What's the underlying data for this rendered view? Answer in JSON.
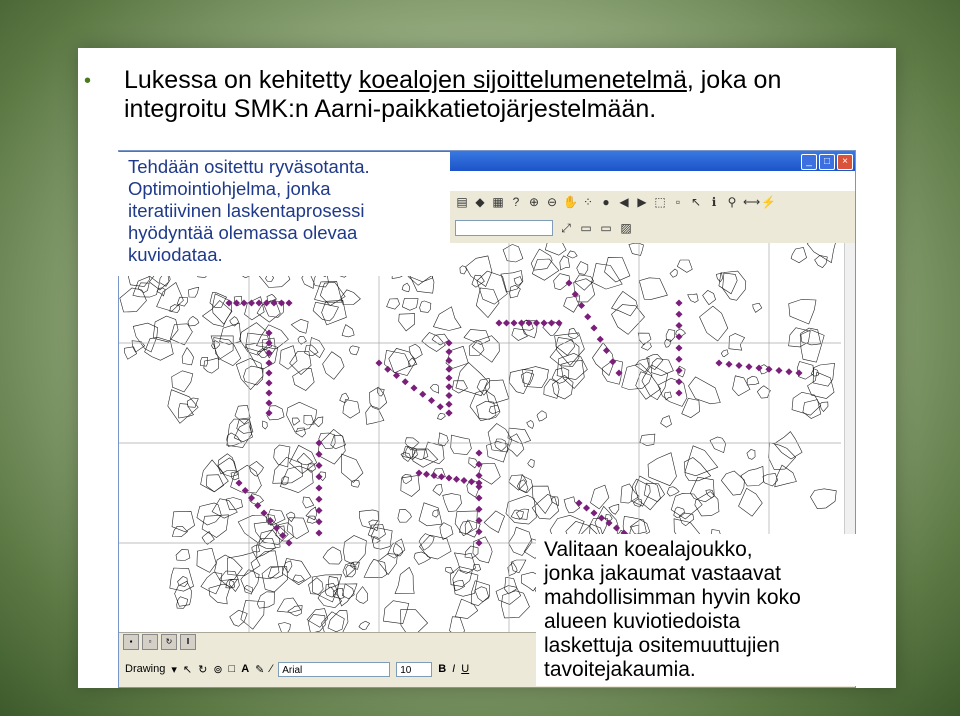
{
  "slide": {
    "headline_pre": "Lukessa on kehitetty ",
    "headline_link": "koealojen sijoittelumenetelmä",
    "headline_post": ", joka on integroitu SMK:n Aarni-paikkatietojärjestelmään.",
    "callout_left": [
      "Tehdään ositettu ryväsotanta.",
      "Optimointiohjelma, jonka",
      "iteratiivinen laskentaprosessi",
      "hyödyntää olemassa olevaa",
      "kuviodataa."
    ],
    "callout_right": [
      "Valitaan koealajoukko,",
      "jonka jakaumat vastaavat",
      "mahdollisimman hyvin koko",
      "alueen kuviotiedoista",
      "laskettuja ositemuuttujien",
      "tavoitejakaumia."
    ]
  },
  "app": {
    "drawing_label": "Drawing",
    "font_name": "Arial",
    "font_size": "10",
    "bold_label": "B",
    "italic_label": "I",
    "underline_label": "U",
    "text_tool_label": "A",
    "toolbar_icons": [
      "zoom-in-icon",
      "zoom-out-icon",
      "pan-icon",
      "full-extent-icon",
      "globe-icon",
      "back-icon",
      "forward-icon",
      "select-icon",
      "info-icon",
      "find-icon",
      "binoculars-icon",
      "measure-icon"
    ],
    "colors": {
      "title_blue": "#1c54c9",
      "sample_point": "#7a1f7a",
      "callout_blue": "#1f3a8a"
    }
  }
}
